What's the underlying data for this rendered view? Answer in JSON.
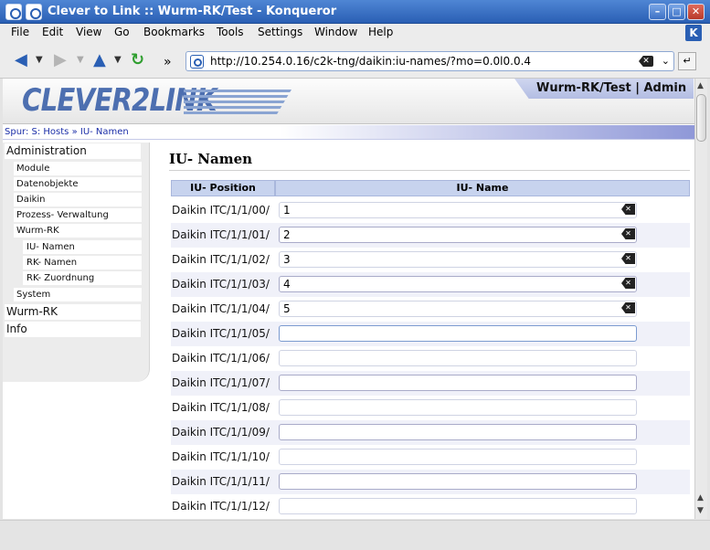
{
  "window": {
    "title": "Clever to Link :: Wurm-RK/Test - Konqueror",
    "minimize": "–",
    "maximize": "□",
    "close": "✕"
  },
  "menu": [
    "File",
    "Edit",
    "View",
    "Go",
    "Bookmarks",
    "Tools",
    "Settings",
    "Window",
    "Help"
  ],
  "toolbar": {
    "url": "http://10.254.0.16/c2k-tng/daikin:iu-names/?mo=0.0l0.0.4",
    "more": "»"
  },
  "site": {
    "logo": "CLEVER2LINK",
    "user_label": "Wurm-RK/Test | Admin",
    "breadcrumb": "Spur: S: Hosts » IU- Namen"
  },
  "sidebar": {
    "main_admin": "Administration",
    "admin_items": [
      "Module",
      "Datenobjekte",
      "Daikin",
      "Prozess- Verwaltung",
      "Wurm-RK"
    ],
    "wurm_items": [
      "IU- Namen",
      "RK- Namen",
      "RK- Zuordnung"
    ],
    "system": "System",
    "main_wurm": "Wurm-RK",
    "main_info": "Info"
  },
  "content": {
    "title": "IU- Namen",
    "col_position": "IU- Position",
    "col_name": "IU- Name",
    "rows": [
      {
        "position": "Daikin ITC/1/1/00/",
        "name": "1"
      },
      {
        "position": "Daikin ITC/1/1/01/",
        "name": "2"
      },
      {
        "position": "Daikin ITC/1/1/02/",
        "name": "3"
      },
      {
        "position": "Daikin ITC/1/1/03/",
        "name": "4"
      },
      {
        "position": "Daikin ITC/1/1/04/",
        "name": "5"
      },
      {
        "position": "Daikin ITC/1/1/05/",
        "name": ""
      },
      {
        "position": "Daikin ITC/1/1/06/",
        "name": ""
      },
      {
        "position": "Daikin ITC/1/1/07/",
        "name": ""
      },
      {
        "position": "Daikin ITC/1/1/08/",
        "name": ""
      },
      {
        "position": "Daikin ITC/1/1/09/",
        "name": ""
      },
      {
        "position": "Daikin ITC/1/1/10/",
        "name": ""
      },
      {
        "position": "Daikin ITC/1/1/11/",
        "name": ""
      },
      {
        "position": "Daikin ITC/1/1/12/",
        "name": ""
      }
    ]
  },
  "colors": {
    "titlebar": "#2a5fb4",
    "header_blue": "#c7d3ee",
    "logo": "#4d6fb0"
  }
}
